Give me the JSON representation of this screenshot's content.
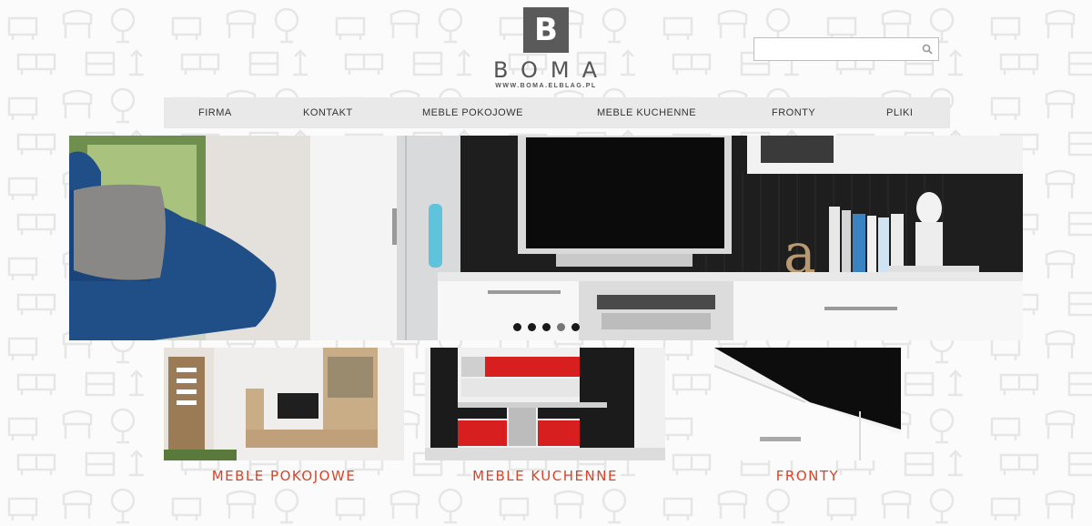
{
  "brand": {
    "mark": "B",
    "name": "BOMA",
    "url": "WWW.BOMA.ELBLAG.PL",
    "color": "#5a5a5a"
  },
  "search": {
    "value": "",
    "placeholder": "",
    "icon": "search-icon"
  },
  "nav": {
    "items": [
      {
        "label": "FIRMA"
      },
      {
        "label": "KONTAKT"
      },
      {
        "label": "MEBLE POKOJOWE"
      },
      {
        "label": "MEBLE KUCHENNE"
      },
      {
        "label": "FRONTY"
      },
      {
        "label": "PLIKI"
      }
    ]
  },
  "slider": {
    "slides_total": 5,
    "active_slide": 4
  },
  "categories": [
    {
      "label": "MEBLE POKOJOWE"
    },
    {
      "label": "MEBLE KUCHENNE"
    },
    {
      "label": "FRONTY"
    }
  ],
  "colors": {
    "accent": "#d4452a",
    "nav_bg": "#e9e9e9",
    "sofa": "#1f4f86"
  }
}
